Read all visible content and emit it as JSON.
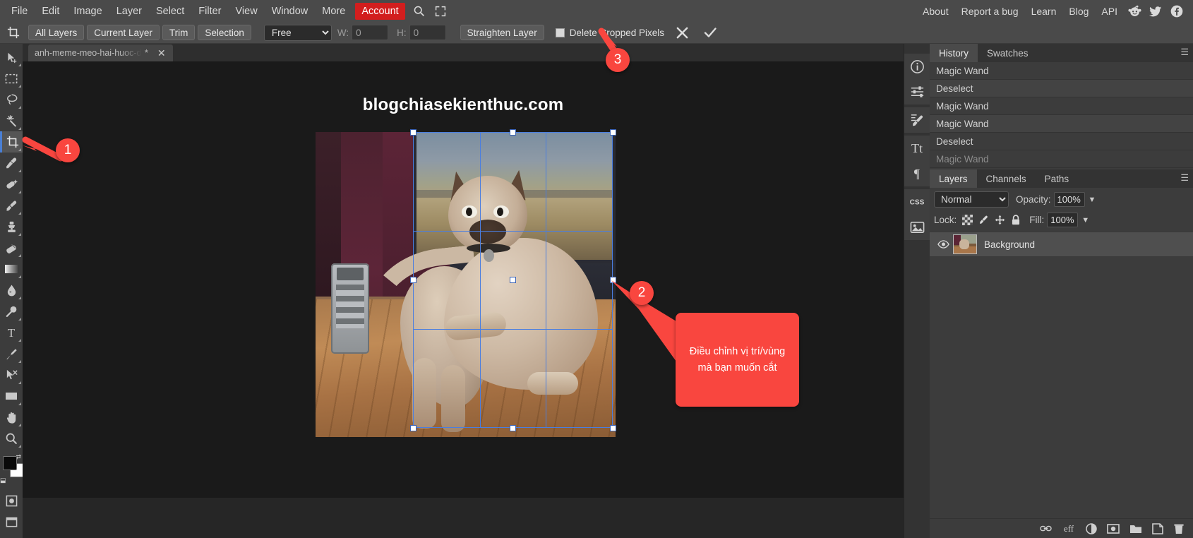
{
  "menu": {
    "items": [
      "File",
      "Edit",
      "Image",
      "Layer",
      "Select",
      "Filter",
      "View",
      "Window",
      "More"
    ],
    "account_label": "Account",
    "search_icon": "search-icon",
    "fullscreen_icon": "fullscreen-icon",
    "right_items": [
      "About",
      "Report a bug",
      "Learn",
      "Blog",
      "API"
    ],
    "social": [
      "reddit-icon",
      "twitter-icon",
      "facebook-icon"
    ],
    "accent_color": "#d21e1e"
  },
  "options_bar": {
    "tool_icon": "crop-icon",
    "buttons": [
      "All Layers",
      "Current Layer",
      "Trim",
      "Selection"
    ],
    "ratio_select": {
      "value": "Free",
      "options": [
        "Free"
      ]
    },
    "width_label": "W:",
    "width_value": "0",
    "height_label": "H:",
    "height_value": "0",
    "straighten_label": "Straighten Layer",
    "delete_cropped_label": "Delete Cropped Pixels",
    "delete_cropped_checked": false,
    "cancel_icon": "close-icon",
    "confirm_icon": "check-icon"
  },
  "toolbar": {
    "tools": [
      {
        "name": "move-tool",
        "icon": "cursor-move-icon",
        "active": false
      },
      {
        "name": "rectangular-marquee-tool",
        "icon": "marquee-icon",
        "active": false
      },
      {
        "name": "lasso-tool",
        "icon": "lasso-icon",
        "active": false
      },
      {
        "name": "magic-wand-tool",
        "icon": "magic-wand-icon",
        "active": false
      },
      {
        "name": "crop-tool",
        "icon": "crop-icon",
        "active": true
      },
      {
        "name": "eyedropper-tool",
        "icon": "eyedropper-icon",
        "active": false
      },
      {
        "name": "healing-brush-tool",
        "icon": "bandage-icon",
        "active": false
      },
      {
        "name": "brush-tool",
        "icon": "paintbrush-icon",
        "active": false
      },
      {
        "name": "clone-stamp-tool",
        "icon": "stamp-icon",
        "active": false
      },
      {
        "name": "eraser-tool",
        "icon": "eraser-icon",
        "active": false
      },
      {
        "name": "gradient-tool",
        "icon": "gradient-icon",
        "active": false
      },
      {
        "name": "blur-tool",
        "icon": "droplet-icon",
        "active": false
      },
      {
        "name": "dodge-tool",
        "icon": "dodge-icon",
        "active": false
      },
      {
        "name": "type-tool",
        "icon": "text-t-icon",
        "active": false
      },
      {
        "name": "pen-tool",
        "icon": "pen-icon",
        "active": false
      },
      {
        "name": "path-select-tool",
        "icon": "path-select-icon",
        "active": false
      },
      {
        "name": "shape-tool",
        "icon": "rectangle-icon",
        "active": false
      },
      {
        "name": "hand-tool",
        "icon": "hand-icon",
        "active": false
      },
      {
        "name": "zoom-tool",
        "icon": "magnifier-icon",
        "active": false
      }
    ],
    "foreground_color": "#0a0a0a",
    "background_color": "#ffffff"
  },
  "document": {
    "tab_name": "anh-meme-meo-hai-huoc-de-th",
    "modified_mark": "*",
    "close_icon": "close-icon",
    "watermark": "blogchiasekienthuc.com"
  },
  "right_dock": {
    "collapse_left": "<>",
    "collapse_right": "><",
    "icons": [
      "info-circle-icon",
      "adjustments-sliders-icon",
      "brush-settings-icon",
      "character-type-icon",
      "paragraph-icon",
      "css-icon",
      "image-icon"
    ]
  },
  "history_panel": {
    "tabs": [
      {
        "label": "History",
        "active": true
      },
      {
        "label": "Swatches",
        "active": false
      }
    ],
    "menu_icon": "hamburger-menu-icon",
    "entries": [
      {
        "label": "Magic Wand",
        "dim": false
      },
      {
        "label": "Deselect",
        "dim": false
      },
      {
        "label": "Magic Wand",
        "dim": false
      },
      {
        "label": "Magic Wand",
        "dim": false
      },
      {
        "label": "Deselect",
        "dim": false
      },
      {
        "label": "Magic Wand",
        "dim": true
      }
    ]
  },
  "layers_panel": {
    "tabs": [
      {
        "label": "Layers",
        "active": true
      },
      {
        "label": "Channels",
        "active": false
      },
      {
        "label": "Paths",
        "active": false
      }
    ],
    "menu_icon": "hamburger-menu-icon",
    "blend_mode": {
      "value": "Normal",
      "options": [
        "Normal"
      ]
    },
    "opacity_label": "Opacity:",
    "opacity_value": "100%",
    "lock_label": "Lock:",
    "lock_icons": [
      "transparency-lock-icon",
      "brush-lock-icon",
      "move-lock-icon",
      "all-lock-icon"
    ],
    "fill_label": "Fill:",
    "fill_value": "100%",
    "layers": [
      {
        "name": "Background",
        "visible": true,
        "thumbnail": "photo-thumbnail"
      }
    ],
    "footer_icons": [
      "link-layers-icon",
      "layer-effects-icon",
      "adjustment-layer-icon",
      "layer-mask-icon",
      "new-group-icon",
      "new-layer-icon",
      "delete-layer-icon"
    ]
  },
  "annotations": [
    {
      "number": "1",
      "target": "crop-tool",
      "color": "#f9463f"
    },
    {
      "number": "2",
      "target": "crop-handle",
      "color": "#f9463f"
    },
    {
      "number": "3",
      "target": "confirm-crop-button",
      "color": "#f9463f"
    }
  ],
  "callout": {
    "text": "Điều chỉnh vị trí/vùng mà bạn muốn cắt",
    "lines": [
      "Điều chỉnh vị",
      "trí/vùng mà bạn",
      "muốn cắt"
    ],
    "color": "#f9463f"
  }
}
